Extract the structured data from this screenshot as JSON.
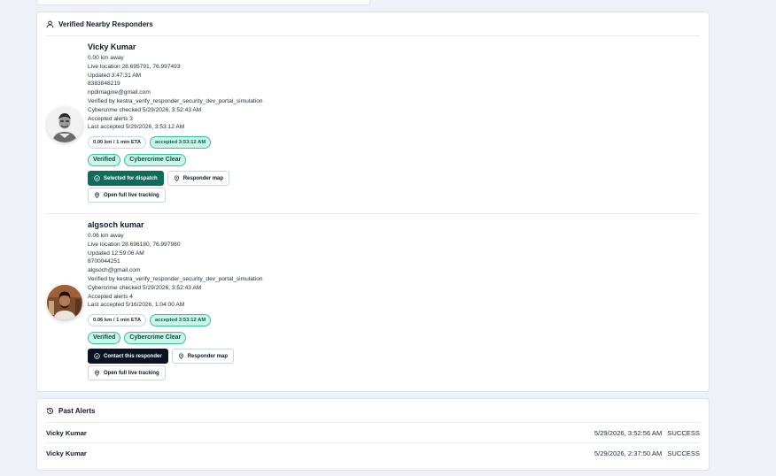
{
  "responders_card": {
    "title": "Verified Nearby Responders",
    "responders": [
      {
        "name": "Vicky Kumar",
        "distance": "0.00 km away",
        "live_location": "Live location 28.695791, 76.997493",
        "updated": "Updated 3:47:31 AM",
        "phone": "8383848219",
        "email": "npdimagine@gmail.com",
        "verified_by": "Verified by kestra_verify_responder_security_dev_portal_simulation",
        "cybercrime_checked": "Cybercrime checked 5/29/2026, 3:52:43 AM",
        "accepted_alerts": "Accepted alerts 3",
        "last_accepted": "Last accepted 5/29/2026, 3:53:12 AM",
        "eta_chip": "0.00 km / 1 min ETA",
        "accepted_chip": "accepted 3:53:12 AM",
        "badge_verified": "Verified",
        "badge_cyber": "Cybercrime Clear",
        "primary_action": "Selected for dispatch",
        "map_action": "Responder map",
        "tracking_action": "Open full live tracking"
      },
      {
        "name": "algsoch kumar",
        "distance": "0.06 km away",
        "live_location": "Live location 28.696180, 76.997980",
        "updated": "Updated 12:59:06 AM",
        "phone": "8700044251",
        "email": "algsoch@gmail.com",
        "verified_by": "Verified by kestra_verify_responder_security_dev_portal_simulation",
        "cybercrime_checked": "Cybercrime checked 5/29/2026, 3:52:43 AM",
        "accepted_alerts": "Accepted alerts 4",
        "last_accepted": "Last accepted 5/16/2026, 1:04:00 AM",
        "eta_chip": "0.06 km / 1 min ETA",
        "accepted_chip": "accepted 3:53:12 AM",
        "badge_verified": "Verified",
        "badge_cyber": "Cybercrime Clear",
        "primary_action": "Contact this responder",
        "map_action": "Responder map",
        "tracking_action": "Open full live tracking"
      }
    ]
  },
  "past_alerts": {
    "title": "Past Alerts",
    "rows": [
      {
        "name": "Vicky Kumar",
        "time": "5/29/2026, 3:52:56 AM",
        "status": "SUCCESS"
      },
      {
        "name": "Vicky Kumar",
        "time": "5/29/2026, 2:37:50 AM",
        "status": "SUCCESS"
      }
    ]
  },
  "icons": {
    "responders_header": "user-icon",
    "past_alerts_header": "history-icon",
    "primary_action": "circle-check-icon",
    "map": "map-pin-icon",
    "tracking": "location-icon"
  },
  "colors": {
    "accent_green": "#0f6b5c",
    "chip_green_bg": "#ccf5ea",
    "dark_button": "#0b1220",
    "page_bg": "#eef2f8"
  }
}
